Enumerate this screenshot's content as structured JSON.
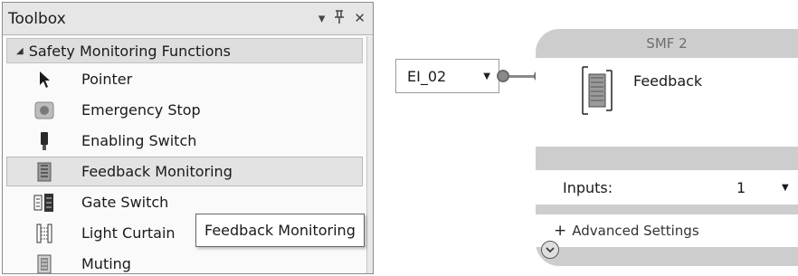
{
  "toolbox": {
    "title": "Toolbox",
    "controls": {
      "dropdown": "▾",
      "pin": "ᛦ",
      "close": "✕"
    },
    "group": {
      "label": "Safety Monitoring Functions",
      "expanded": true
    },
    "items": [
      {
        "label": "Pointer",
        "icon": "pointer-icon",
        "selected": false
      },
      {
        "label": "Emergency Stop",
        "icon": "emergency-stop-icon",
        "selected": false
      },
      {
        "label": "Enabling Switch",
        "icon": "enabling-switch-icon",
        "selected": false
      },
      {
        "label": "Feedback Monitoring",
        "icon": "feedback-monitoring-icon",
        "selected": true
      },
      {
        "label": "Gate Switch",
        "icon": "gate-switch-icon",
        "selected": false
      },
      {
        "label": "Light Curtain",
        "icon": "light-curtain-icon",
        "selected": false
      },
      {
        "label": "Muting",
        "icon": "muting-icon",
        "selected": false
      }
    ],
    "tooltip": "Feedback Monitoring"
  },
  "diagram": {
    "input": {
      "value": "EI_02"
    },
    "smf": {
      "title": "SMF 2",
      "function_label": "Feedback",
      "inputs_label": "Inputs:",
      "inputs_value": "1",
      "advanced_label": "Advanced Settings",
      "advanced_prefix": "+"
    }
  },
  "colors": {
    "block_background": "#cdcdcd",
    "selection": "#e3e3e3",
    "header": "#e6e6e6"
  }
}
